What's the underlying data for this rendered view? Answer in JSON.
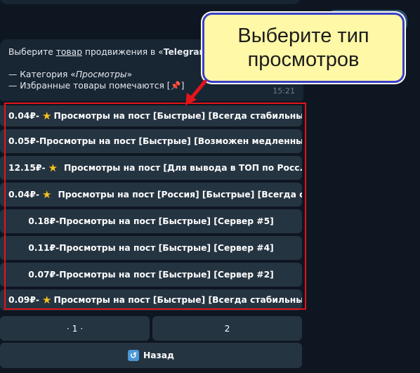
{
  "message": {
    "line1_pre": "Выберите ",
    "line1_link": "товар",
    "line1_mid": " продвижения в «",
    "line1_bold": "Telegram",
    "line1_post": "»",
    "line2_pre": "— Категория «",
    "line2_italic": "Просмотры",
    "line2_post": "»",
    "line3": "— Избранные товары помечаются [",
    "line3_icon": "pushpin-icon",
    "line3_post": "]",
    "time": "15:21"
  },
  "keyboard": {
    "buttons": [
      {
        "price": "0.04₽",
        "sep": " - ",
        "star": true,
        "flag": false,
        "label": "Просмотры на пост [Быстрые] [Всегда стабильны] ..."
      },
      {
        "price": "0.05₽",
        "sep": " - ",
        "star": false,
        "flag": false,
        "label": "Просмотры на пост [Быстрые] [Возможен медленный ..."
      },
      {
        "price": "12.15₽",
        "sep": " - ",
        "star": true,
        "flag": true,
        "label": "Просмотры на пост [Для вывода в ТОП по Росс..."
      },
      {
        "price": "0.04₽",
        "sep": " - ",
        "star": true,
        "flag": true,
        "label": "Просмотры на пост [Россия] [Быстрые] [Всегда с..."
      },
      {
        "price": "0.18₽",
        "sep": " - ",
        "star": false,
        "flag": false,
        "label": "Просмотры на пост [Быстрые] [Сервер #5]"
      },
      {
        "price": "0.11₽",
        "sep": " - ",
        "star": false,
        "flag": false,
        "label": "Просмотры на пост [Быстрые] [Сервер #4]"
      },
      {
        "price": "0.07₽",
        "sep": " - ",
        "star": false,
        "flag": false,
        "label": "Просмотры на пост [Быстрые] [Сервер #2]"
      },
      {
        "price": "0.09₽",
        "sep": " - ",
        "star": true,
        "flag": false,
        "label": "Просмотры на пост [Быстрые] [Всегда стабильны] ..."
      }
    ],
    "pagination": {
      "page1": "· 1 ·",
      "page2": "2"
    },
    "back_label": "Назад",
    "back_icon": "back-arrow-icon"
  },
  "callout": {
    "text": "Выберите тип\nпросмотров"
  },
  "colors": {
    "background": "#0e1621",
    "bubble": "#182533",
    "button": "#253441",
    "highlight": "#e3141a",
    "callout_bg": "#fff8a6",
    "callout_border": "#3a3fc7"
  }
}
